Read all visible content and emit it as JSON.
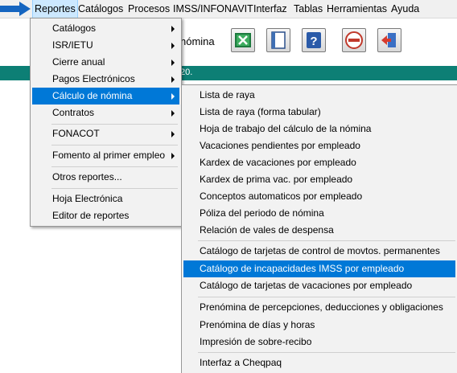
{
  "menubar": {
    "items": [
      {
        "id": "reportes",
        "label": "Reportes"
      },
      {
        "id": "catalogos",
        "label": "Catálogos"
      },
      {
        "id": "procesos",
        "label": "Procesos"
      },
      {
        "id": "imss",
        "label": "IMSS/INFONAVIT"
      },
      {
        "id": "interfaz",
        "label": "Interfaz"
      },
      {
        "id": "tablas",
        "label": "Tablas"
      },
      {
        "id": "herramientas",
        "label": "Herramientas"
      },
      {
        "id": "ayuda",
        "label": "Ayuda"
      }
    ],
    "active": "Reportes"
  },
  "toolbar": {
    "partial_label": "nómina",
    "buttons": [
      {
        "icon": "excel-icon"
      },
      {
        "icon": "window-icon"
      },
      {
        "icon": "help-icon"
      },
      {
        "icon": "stamp-icon"
      },
      {
        "icon": "exit-icon"
      }
    ]
  },
  "status_bar": {
    "partial_text": "20."
  },
  "reportes_menu": {
    "items": [
      {
        "label": "Catálogos",
        "has_submenu": true
      },
      {
        "label": "ISR/IETU",
        "has_submenu": true
      },
      {
        "label": "Cierre anual",
        "has_submenu": true
      },
      {
        "label": "Pagos Electrónicos",
        "has_submenu": true
      },
      {
        "label": "Cálculo de nómina",
        "has_submenu": true,
        "highlighted": true
      },
      {
        "label": "Contratos",
        "has_submenu": true
      },
      {
        "label": "FONACOT",
        "has_submenu": true
      },
      {
        "label": "Fomento al primer empleo",
        "has_submenu": true
      },
      {
        "label": "Otros reportes..."
      },
      {
        "label": "Hoja Electrónica"
      },
      {
        "label": "Editor de reportes"
      }
    ]
  },
  "calculo_submenu": {
    "items": [
      {
        "label": "Lista de raya"
      },
      {
        "label": "Lista de raya (forma tabular)"
      },
      {
        "label": "Hoja de trabajo del cálculo de la nómina"
      },
      {
        "label": "Vacaciones pendientes por empleado"
      },
      {
        "label": "Kardex de vacaciones por empleado"
      },
      {
        "label": "Kardex de prima vac. por empleado"
      },
      {
        "label": "Conceptos automaticos por empleado"
      },
      {
        "label": "Póliza del periodo de nómina"
      },
      {
        "label": "Relación de vales de despensa"
      },
      {
        "label": "Catálogo de tarjetas de control de movtos. permanentes"
      },
      {
        "label": "Catálogo de incapacidades IMSS por empleado",
        "highlighted": true
      },
      {
        "label": "Catálogo de tarjetas de vacaciones por empleado"
      },
      {
        "label": "Prenómina de percepciones, deducciones y obligaciones"
      },
      {
        "label": "Prenómina de días y horas"
      },
      {
        "label": "Impresión de sobre-recibo"
      },
      {
        "label": "Interfaz a Cheqpaq"
      }
    ]
  },
  "colors": {
    "highlight": "#0078d7",
    "menubar_active": "#cce8ff",
    "status_bar": "#0d7f75",
    "pointer_arrow": "#1565c0"
  }
}
